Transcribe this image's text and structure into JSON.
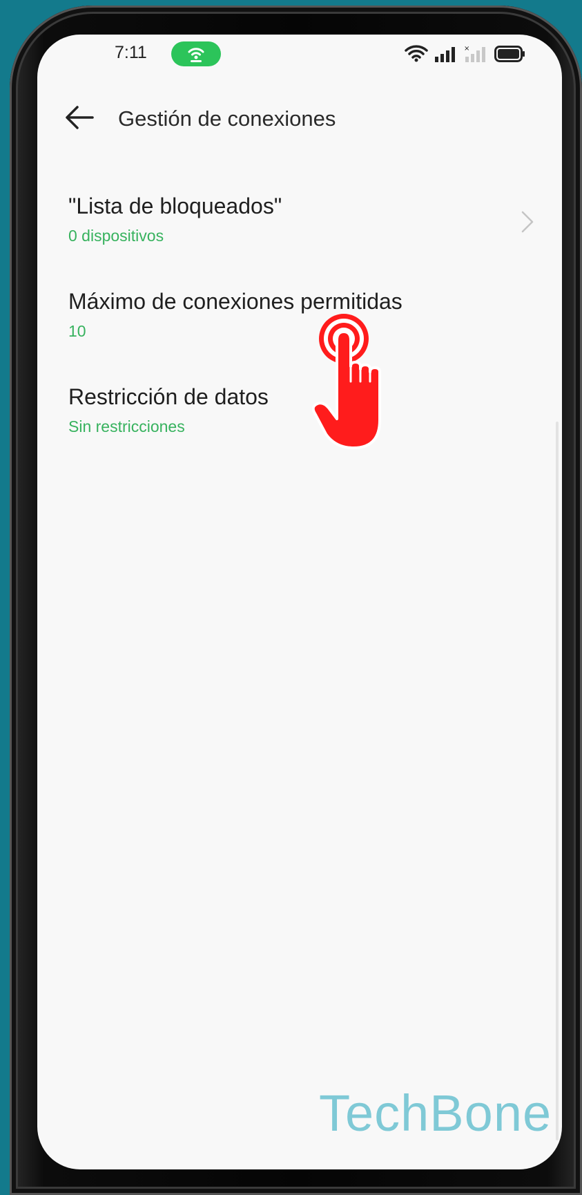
{
  "status_bar": {
    "time": "7:11",
    "icons": [
      "hotspot-icon",
      "wifi-icon",
      "signal-icon",
      "signal-no-service-icon",
      "battery-icon"
    ]
  },
  "header": {
    "title": "Gestión de conexiones"
  },
  "settings": [
    {
      "title": "\"Lista de bloqueados\"",
      "subtitle": "0 dispositivos"
    },
    {
      "title": "Máximo de conexiones permitidas",
      "subtitle": "10"
    },
    {
      "title": "Restricción de datos",
      "subtitle": "Sin restricciones"
    }
  ],
  "watermark": "TechBone",
  "colors": {
    "accent_green": "#37b25e",
    "hotspot_pill": "#2cc45a",
    "tap_indicator": "#ff1c1c",
    "background": "#137a8c"
  }
}
